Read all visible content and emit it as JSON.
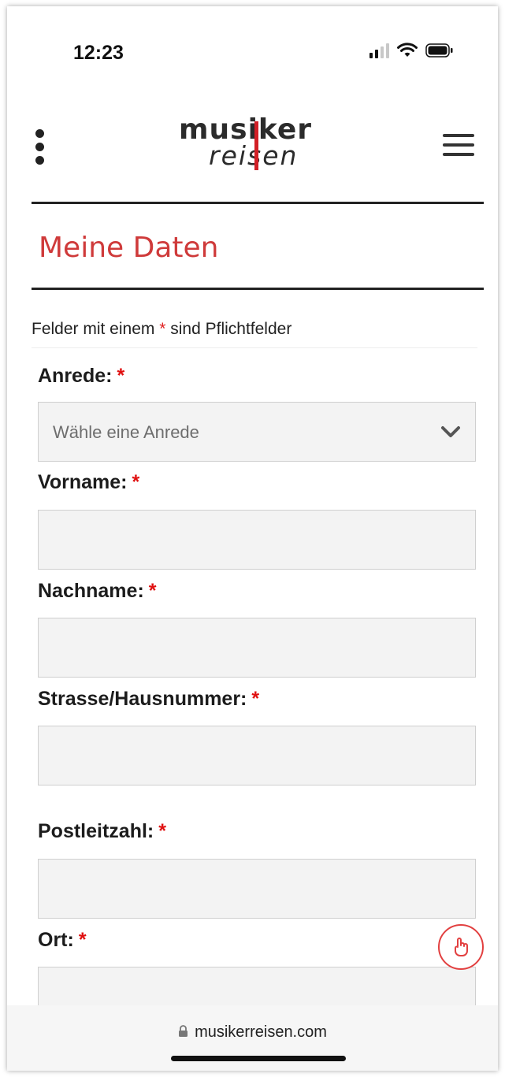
{
  "status_bar": {
    "time": "12:23"
  },
  "header": {
    "logo_top": "musiker",
    "logo_bottom": "reisen"
  },
  "page": {
    "title": "Meine Daten",
    "required_note_before": "Felder mit einem ",
    "required_star": "*",
    "required_note_after": " sind Pflichtfelder"
  },
  "form": {
    "anrede": {
      "label": "Anrede:",
      "star": "*",
      "placeholder": "Wähle eine Anrede"
    },
    "vorname": {
      "label": "Vorname:",
      "star": "*",
      "value": ""
    },
    "nachname": {
      "label": "Nachname:",
      "star": "*",
      "value": ""
    },
    "strasse": {
      "label": "Strasse/Hausnummer:",
      "star": "*",
      "value": ""
    },
    "plz": {
      "label": "Postleitzahl:",
      "star": "*",
      "value": ""
    },
    "ort": {
      "label": "Ort:",
      "star": "*",
      "value": ""
    }
  },
  "browser": {
    "url": "musikerreisen.com"
  },
  "colors": {
    "accent_red": "#cf3a3a",
    "required_red": "#e01010",
    "logo_bar": "#d21f26"
  },
  "icons": {
    "kebab": "kebab-menu-icon",
    "menu": "hamburger-menu-icon",
    "chevron": "chevron-down-icon",
    "help": "hand-pointer-icon",
    "lock": "lock-icon"
  }
}
